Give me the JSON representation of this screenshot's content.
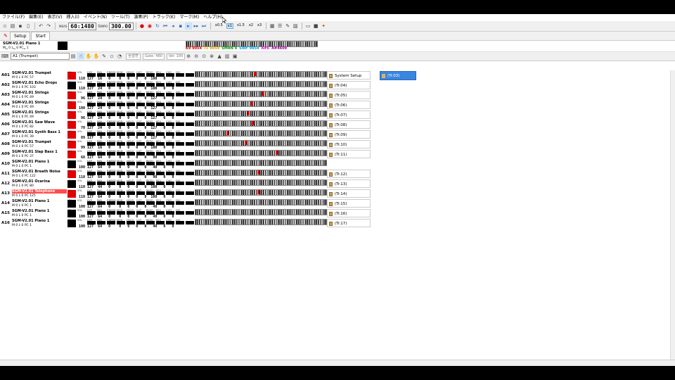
{
  "menu": [
    "ファイル(F)",
    "編集(E)",
    "表示(V)",
    "挿入(I)",
    "イベント(N)",
    "ツール(T)",
    "演奏(P)",
    "トラック(K)",
    "マーク(M)",
    "ヘルプ(H)"
  ],
  "toolbar": {
    "meas_label": "MEAS",
    "position": "60:1480",
    "tempo_label": "TEMPO",
    "tempo": "300.00",
    "speeds": [
      "x0.5",
      "x1",
      "x1.5",
      "x2",
      "x3"
    ],
    "active_speed": "x1"
  },
  "tabs": [
    "Setup",
    "Start"
  ],
  "top_track": {
    "name": "SGM-V2.01 Piano 1",
    "sub": "M␣ 0 L␣ 0 PC␣ 1",
    "status": [
      "K9 9054",
      "TL 8054",
      "SMRN 4",
      "SIRF 9854",
      "A#6",
      "A#4609"
    ],
    "status_colors": [
      "#e00000",
      "#e0a000",
      "#00a000",
      "#00a0e0",
      "#e000e0",
      "#a000a0"
    ]
  },
  "toolbar2": {
    "instrument": "A1 (Trumpet)",
    "group": "全音符",
    "gate": "Gate: 480",
    "vel": "Vel: 100"
  },
  "headers": [
    "VEL",
    "VOL",
    "EXP",
    "PAN",
    "P.BEND",
    "MOD",
    "HOLD",
    "CUT",
    "RESO",
    "REV",
    "CHO",
    "DLY"
  ],
  "tracks": [
    {
      "id": "A01",
      "name": "SGM-V2.01 Trumpet",
      "pc": "57",
      "color": "#e00000",
      "vals": "110 127  16   0    0   0   0   0  100   0   0",
      "kb": [
        83
      ]
    },
    {
      "id": "A02",
      "name": "SGM-V2.01 Echo Drops",
      "pc": "103",
      "color": "#000000",
      "vals": "110 127  24   0    0   0   0   0  100   0   0",
      "kb": []
    },
    {
      "id": "A03",
      "name": "SGM-V2.01 Strings",
      "pc": "49",
      "color": "#e00000",
      "vals": " 96 127  24   0    0   0   0   0  127   0   0",
      "kb": [
        95
      ]
    },
    {
      "id": "A04",
      "name": "SGM-V2.01 Strings",
      "pc": "49",
      "color": "#e00000",
      "vals": "100 127  24   0    0   0   0   0  127   0   0",
      "kb": [
        79
      ]
    },
    {
      "id": "A05",
      "name": "SGM-V2.01 Strings",
      "pc": "49",
      "color": "#e00000",
      "vals": " 96 127  24   0    0   0   0   0  127   0   0",
      "kb": [
        74
      ]
    },
    {
      "id": "A06",
      "name": "SGM-V2.01 Saw Wave",
      "pc": "82",
      "color": "#e00000",
      "vals": " 70 127  24   0    0   0   0   0  127   0   0",
      "kb": [
        80
      ]
    },
    {
      "id": "A07",
      "name": "SGM-V2.01 Synth Bass 1",
      "pc": "39",
      "color": "#e00000",
      "vals": " 89 127   0   0    0   0   0   0  127   0   0",
      "kb": [
        44
      ]
    },
    {
      "id": "A08",
      "name": "SGM-V2.01 Trumpet",
      "pc": "57",
      "color": "#e00000",
      "vals": " 99 127  16   0    0   0   0   0  100   0   0",
      "kb": [
        70
      ]
    },
    {
      "id": "A09",
      "name": "SGM-V2.01 Slap Bass 1",
      "pc": "37",
      "color": "#e00000",
      "vals": " 68 127  64   0    0   0   0   0   90   0   0",
      "kb": [
        114
      ]
    },
    {
      "id": "A10",
      "name": "SGM-V2.01 Piano 1",
      "pc": "1",
      "color": "#000000",
      "vals": "100 127  64   0    0   0   0   0   40   0   0",
      "kb": []
    },
    {
      "id": "A11",
      "name": "SGM-V2.01 Breath Noise",
      "pc": "122",
      "color": "#e00000",
      "vals": "110 127  64   0    0   0   0   0   90   0   0",
      "kb": [
        88
      ]
    },
    {
      "id": "A12",
      "name": "SGM-V2.01 Ocarina",
      "pc": "80",
      "color": "#000000",
      "vals": "110 127  44   0    0   0   0   0  100   0   0",
      "kb": []
    },
    {
      "id": "A13",
      "name": "SGM-V2.01 Telephone",
      "pc": "125",
      "color": "#e00000",
      "vals": "110 127  64   0    0   0   0   0  100   0   0",
      "kb": [
        88
      ]
    },
    {
      "id": "A14",
      "name": "SGM-V2.01 Piano 1",
      "pc": "1",
      "color": "#000000",
      "vals": "100 127  64   0    0   0   0   0   40   0   0",
      "kb": []
    },
    {
      "id": "A15",
      "name": "SGM-V2.01 Piano 1",
      "pc": "1",
      "color": "#000000",
      "vals": "100 127  64   0    0   0   0   0   40   0   0",
      "kb": []
    },
    {
      "id": "A16",
      "name": "SGM-V2.01 Piano 1",
      "pc": "1",
      "color": "#000000",
      "vals": "100 127  64   0    0   0   0   0   40   0   0",
      "kb": []
    }
  ],
  "panel": [
    "System Setup",
    "(Tr.04)",
    "(Tr.05)",
    "(Tr.06)",
    "(Tr.07)",
    "(Tr.08)",
    "(Tr.09)",
    "(Tr.10)",
    "(Tr.11)",
    "",
    "(Tr.12)",
    "(Tr.13)",
    "(Tr.14)",
    "(Tr.15)",
    "(Tr.16)",
    "(Tr.17)"
  ],
  "selected_track": "(Tr.03)",
  "selected_row": 12
}
